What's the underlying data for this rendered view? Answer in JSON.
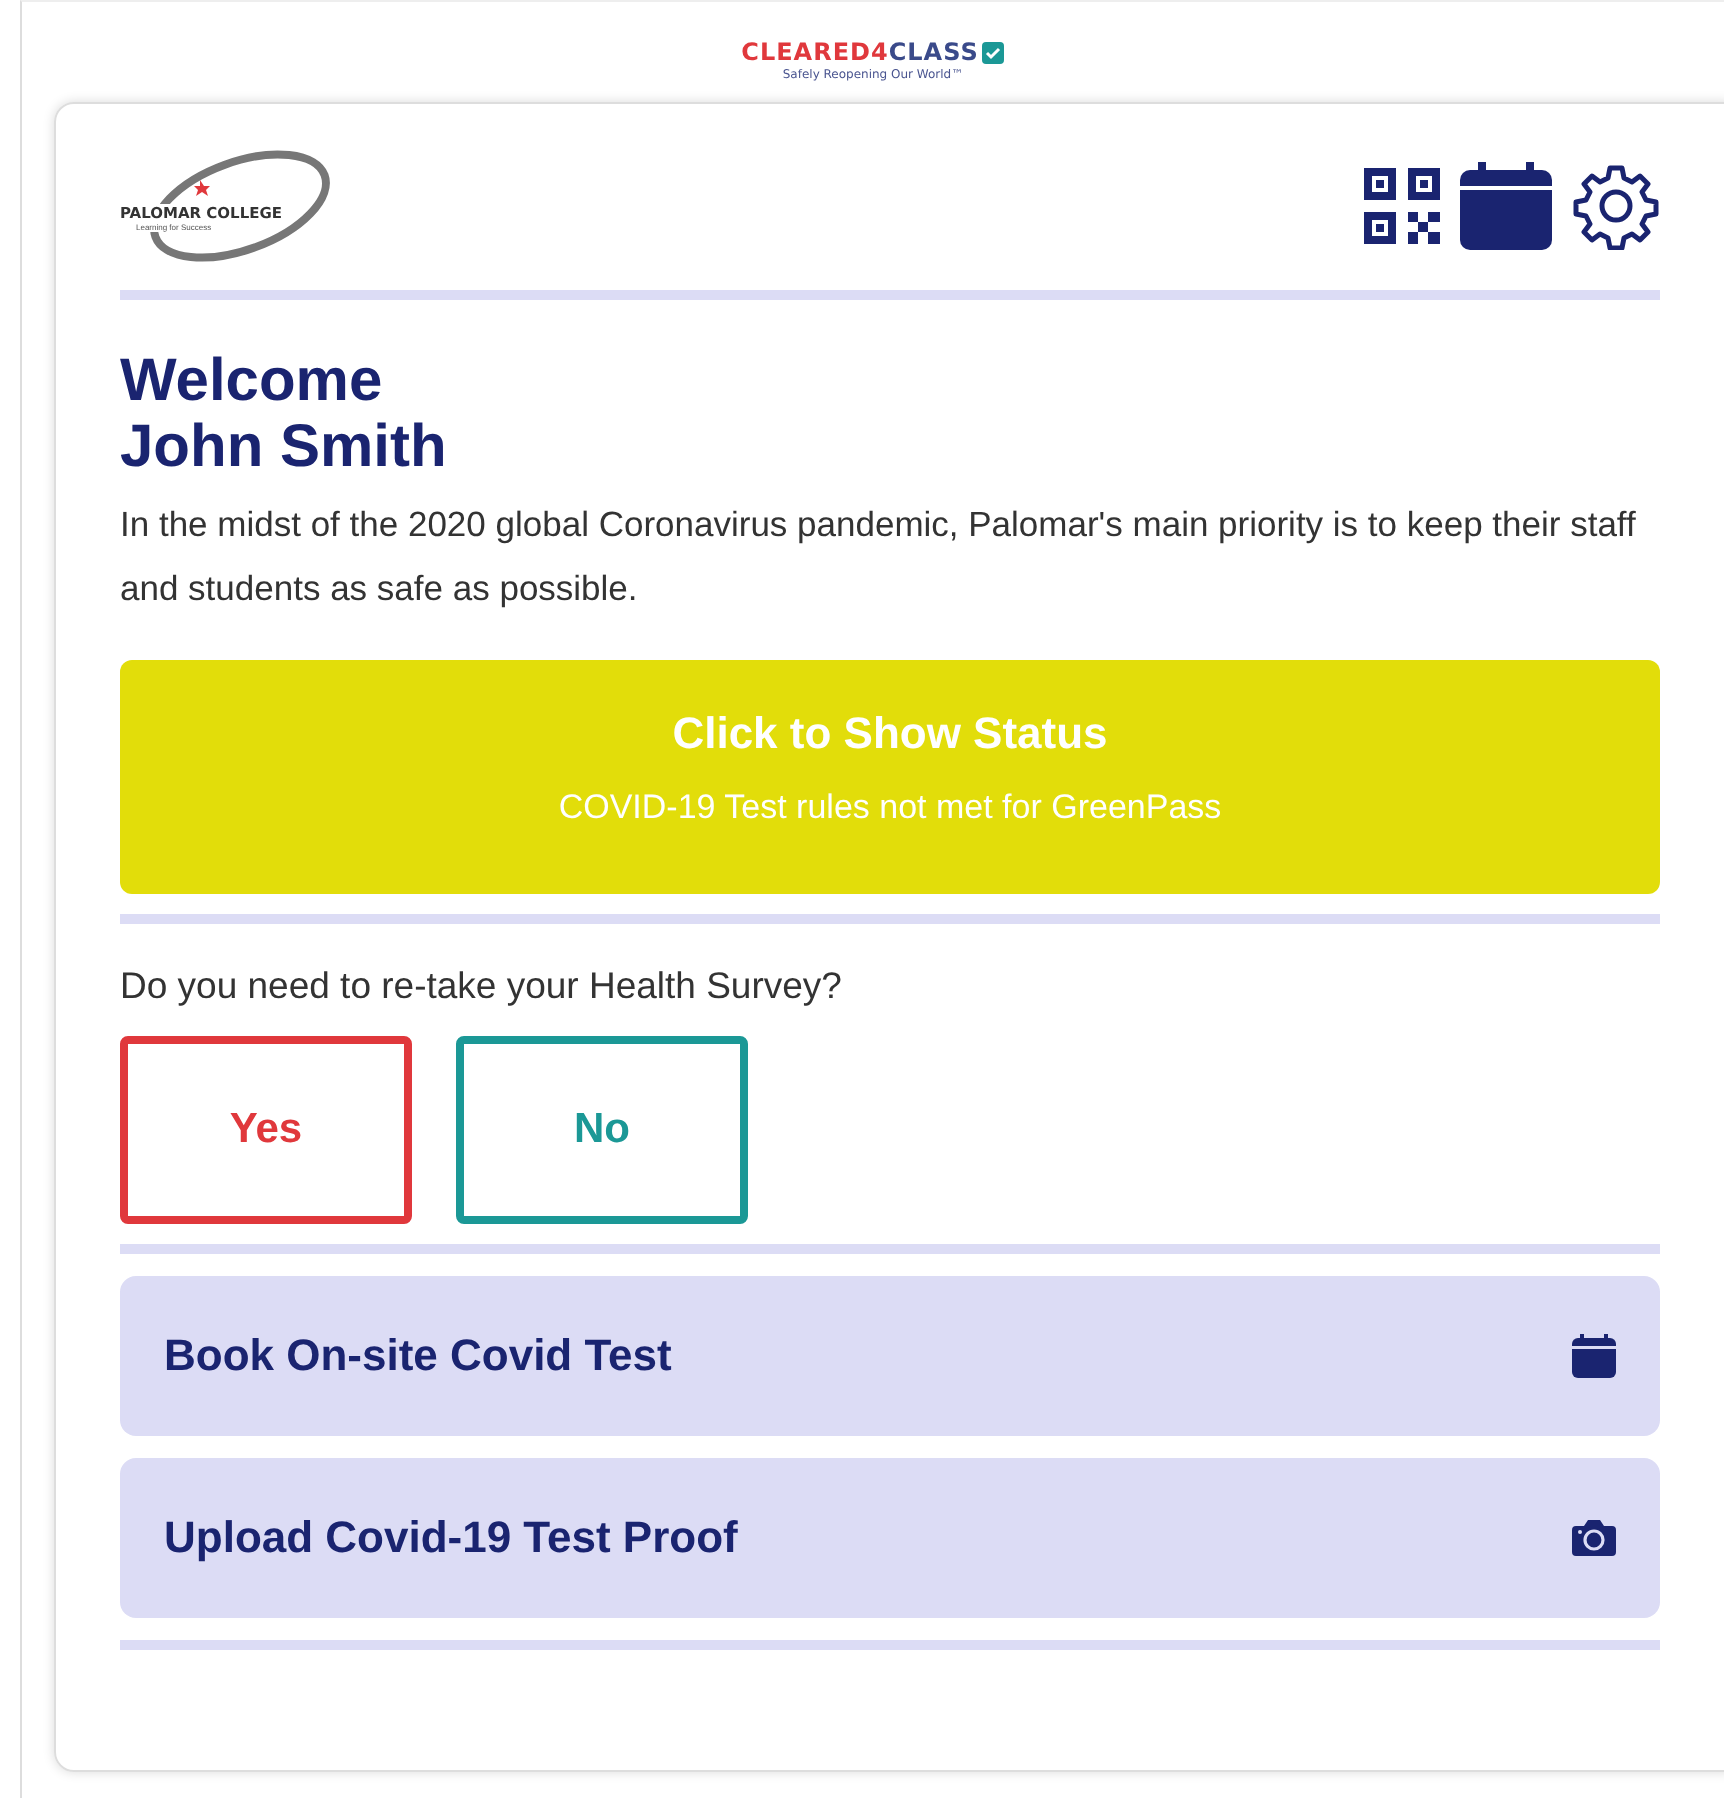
{
  "brand": {
    "name_part_1": "CLEARED4",
    "name_part_2": "CLASS",
    "tagline": "Safely Reopening Our World™"
  },
  "logo": {
    "name": "PALOMAR COLLEGE",
    "motto": "Learning for Success"
  },
  "toolbar": [
    {
      "kind": "qr"
    },
    {
      "kind": "calendar"
    },
    {
      "kind": "settings"
    }
  ],
  "welcome": {
    "greeting": "Welcome",
    "name": "John Smith",
    "intro": "In the midst of the 2020 global Coronavirus pandemic, Palomar's main priority is to keep their staff and students as safe as possible."
  },
  "status_button": {
    "title": "Click to Show Status",
    "subtitle": "COVID-19 Test rules not met for GreenPass"
  },
  "survey": {
    "question": "Do you need to re-take your Health Survey?",
    "options": [
      {
        "label": "Yes",
        "color": "#e0383c"
      },
      {
        "label": "No",
        "color": "#1b9896"
      }
    ]
  },
  "actions": [
    {
      "label": "Book On-site Covid Test",
      "kind": "calendar"
    },
    {
      "label": "Upload Covid-19 Test Proof",
      "kind": "camera"
    }
  ]
}
